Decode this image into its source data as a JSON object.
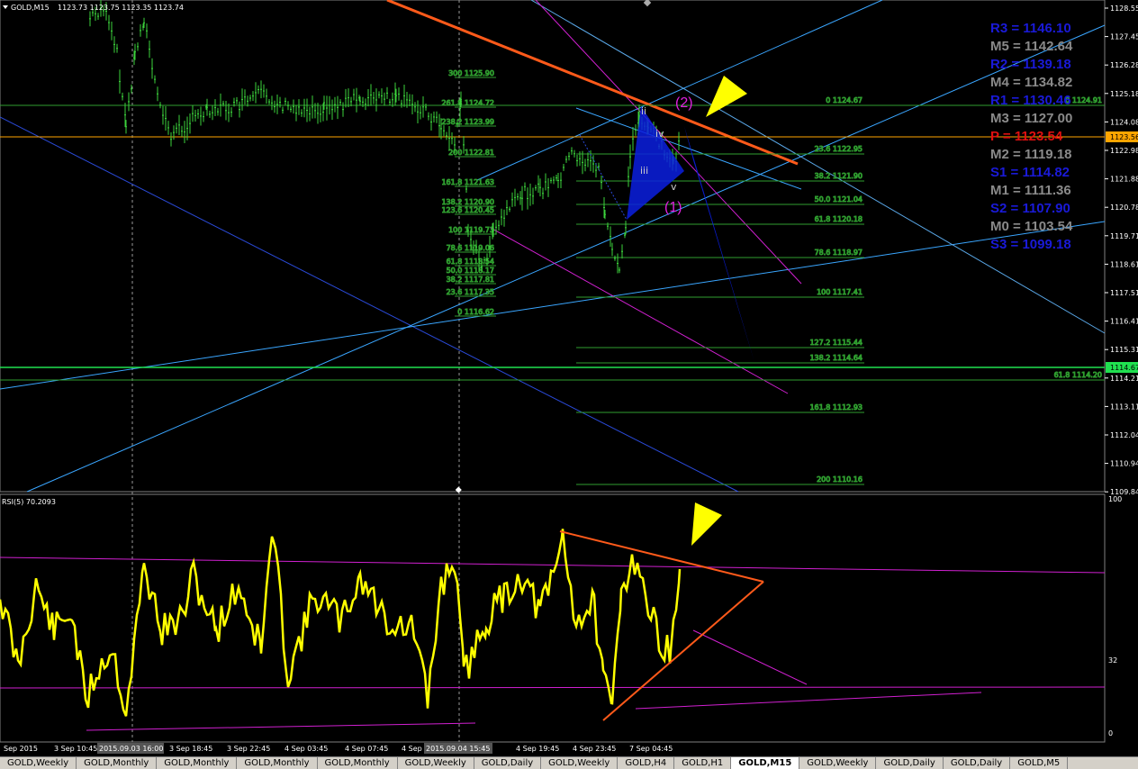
{
  "header": {
    "symbol_tf": "GOLD,M15",
    "ohlc": "1123.73 1123.75 1123.35 1123.74"
  },
  "rsi_header": "RSI(5) 70.2093",
  "price_axis": [
    "1128.55",
    "1127.45",
    "1126.28",
    "1125.18",
    "1124.08",
    "1122.98",
    "1121.88",
    "1120.78",
    "1119.71",
    "1118.61",
    "1117.51",
    "1116.41",
    "1115.31",
    "1114.21",
    "1113.11",
    "1112.04",
    "1110.94",
    "1109.84"
  ],
  "price_tags": {
    "current": "1123.56",
    "green": "1114.67"
  },
  "rsi_axis": [
    "100",
    "32",
    "0"
  ],
  "time_axis": [
    "Sep 2015",
    "3 Sep 10:45",
    "3 Sep 14:45",
    "3 Sep 18:45",
    "3 Sep 22:45",
    "4 Sep 03:45",
    "4 Sep 07:45",
    "4 Sep",
    "4 Sep 15:45",
    "4 Sep 19:45",
    "4 Sep 23:45",
    "7 Sep 04:45"
  ],
  "vline_tags": [
    "2015.09.03 16:00",
    "2015.09.04 15:45"
  ],
  "fib_right": [
    "0 1124.67",
    "23.6 1122.95",
    "38.2 1121.90",
    "50.0 1121.04",
    "61.8 1120.18",
    "78.6 1118.97",
    "100 1117.41",
    "127.2 1115.44",
    "138.2 1114.64",
    "161.8 1112.93",
    "200 1110.16"
  ],
  "fib_left": [
    "300 1125.90",
    "261.8 1124.72",
    "238.2 1123.99",
    "200 1122.81",
    "161.8 1121.63",
    "138.2 1120.90",
    "123.6 1120.45",
    "100 1119.73",
    "78.6 1119.06",
    "61.8 1118.54",
    "50.0 1118.17",
    "38.2 1117.81",
    "23.6 1117.35",
    "0 1116.62"
  ],
  "fib_extra": [
    "0 1124.91",
    "61.8 1114.20"
  ],
  "pivots": [
    {
      "label": "R3 = 1146.10",
      "color": "#1a1ad8"
    },
    {
      "label": "M5 = 1142.64",
      "color": "#8a8a8a"
    },
    {
      "label": "R2 = 1139.18",
      "color": "#1a1ad8"
    },
    {
      "label": "M4 = 1134.82",
      "color": "#8a8a8a"
    },
    {
      "label": "R1 = 1130.46",
      "color": "#1a1ad8"
    },
    {
      "label": "M3 = 1127.00",
      "color": "#8a8a8a"
    },
    {
      "label": "P  = 1123.54",
      "color": "#e01010"
    },
    {
      "label": "M2 = 1119.18",
      "color": "#8a8a8a"
    },
    {
      "label": "S1 = 1114.82",
      "color": "#1a1ad8"
    },
    {
      "label": "M1 = 1111.36",
      "color": "#8a8a8a"
    },
    {
      "label": "S2 = 1107.90",
      "color": "#1a1ad8"
    },
    {
      "label": "M0 = 1103.54",
      "color": "#8a8a8a"
    },
    {
      "label": "S3 = 1099.18",
      "color": "#1a1ad8"
    }
  ],
  "waves": {
    "i": "i",
    "ii": "ii",
    "iii": "iii",
    "iv": "iv",
    "v": "v",
    "w1": "(1)",
    "w2": "(2)"
  },
  "tabs": [
    {
      "label": "GOLD,Weekly",
      "active": false
    },
    {
      "label": "GOLD,Monthly",
      "active": false
    },
    {
      "label": "GOLD,Monthly",
      "active": false
    },
    {
      "label": "GOLD,Monthly",
      "active": false
    },
    {
      "label": "GOLD,Monthly",
      "active": false
    },
    {
      "label": "GOLD,Weekly",
      "active": false
    },
    {
      "label": "GOLD,Daily",
      "active": false
    },
    {
      "label": "GOLD,Weekly",
      "active": false
    },
    {
      "label": "GOLD,H4",
      "active": false
    },
    {
      "label": "GOLD,H1",
      "active": false
    },
    {
      "label": "GOLD,M15",
      "active": true
    },
    {
      "label": "GOLD,Weekly",
      "active": false
    },
    {
      "label": "GOLD,Daily",
      "active": false
    },
    {
      "label": "GOLD,Daily",
      "active": false
    },
    {
      "label": "GOLD,M5",
      "active": false
    }
  ],
  "colors": {
    "candles": "#3cd23c",
    "rsi": "#ffff00",
    "fib": "#2f9e2f",
    "trend_orange": "#ff5a1a",
    "channel_blue": "#3aa6ff",
    "magenta": "#d020d0",
    "triangle": "#0a1ee0",
    "arrow": "#ffff00"
  }
}
